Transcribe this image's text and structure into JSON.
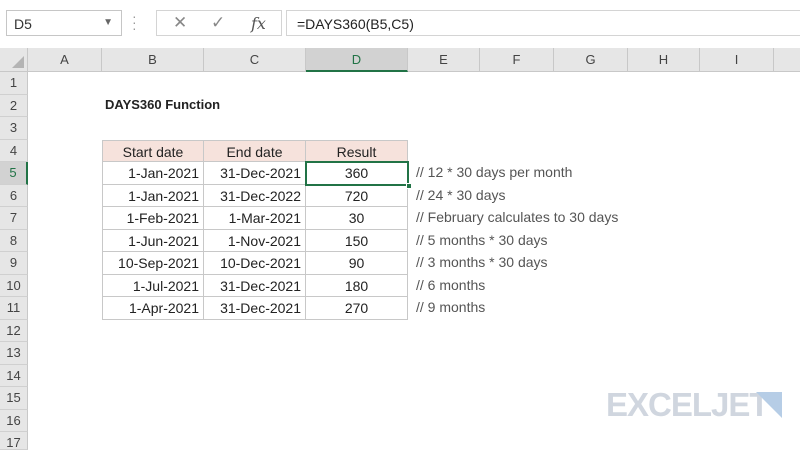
{
  "formula_bar": {
    "name_box": "D5",
    "name_box_arrow": "▼",
    "cancel_glyph": "✕",
    "enter_glyph": "✓",
    "fx_glyph": "fx",
    "formula": "=DAYS360(B5,C5)"
  },
  "columns": [
    "A",
    "B",
    "C",
    "D",
    "E",
    "F",
    "G",
    "H",
    "I"
  ],
  "selected_column": "D",
  "rows": [
    "1",
    "2",
    "3",
    "4",
    "5",
    "6",
    "7",
    "8",
    "9",
    "10",
    "11",
    "12",
    "13",
    "14",
    "15",
    "16",
    "17"
  ],
  "selected_row": "5",
  "sheet": {
    "title": "DAYS360 Function",
    "headers": {
      "start": "Start date",
      "end": "End date",
      "result": "Result"
    },
    "table": [
      {
        "start": "1-Jan-2021",
        "end": "31-Dec-2021",
        "result": "360",
        "comment": "//  12 * 30 days per month"
      },
      {
        "start": "1-Jan-2021",
        "end": "31-Dec-2022",
        "result": "720",
        "comment": "// 24 * 30 days"
      },
      {
        "start": "1-Feb-2021",
        "end": "1-Mar-2021",
        "result": "30",
        "comment": "//  February calculates to 30 days"
      },
      {
        "start": "1-Jun-2021",
        "end": "1-Nov-2021",
        "result": "150",
        "comment": "//  5 months * 30 days"
      },
      {
        "start": "10-Sep-2021",
        "end": "10-Dec-2021",
        "result": "90",
        "comment": "//  3 months * 30 days"
      },
      {
        "start": "1-Jul-2021",
        "end": "31-Dec-2021",
        "result": "180",
        "comment": "//  6 months"
      },
      {
        "start": "1-Apr-2021",
        "end": "31-Dec-2021",
        "result": "270",
        "comment": "// 9 months"
      }
    ]
  },
  "logo": {
    "text": "EXCELJET"
  },
  "colors": {
    "accent": "#217346",
    "header_fill": "#f6e2dc",
    "logo": "#d0d6df"
  },
  "icons": [
    "cancel-icon",
    "enter-icon",
    "function-icon",
    "dropdown-arrow-icon",
    "select-all-icon"
  ]
}
